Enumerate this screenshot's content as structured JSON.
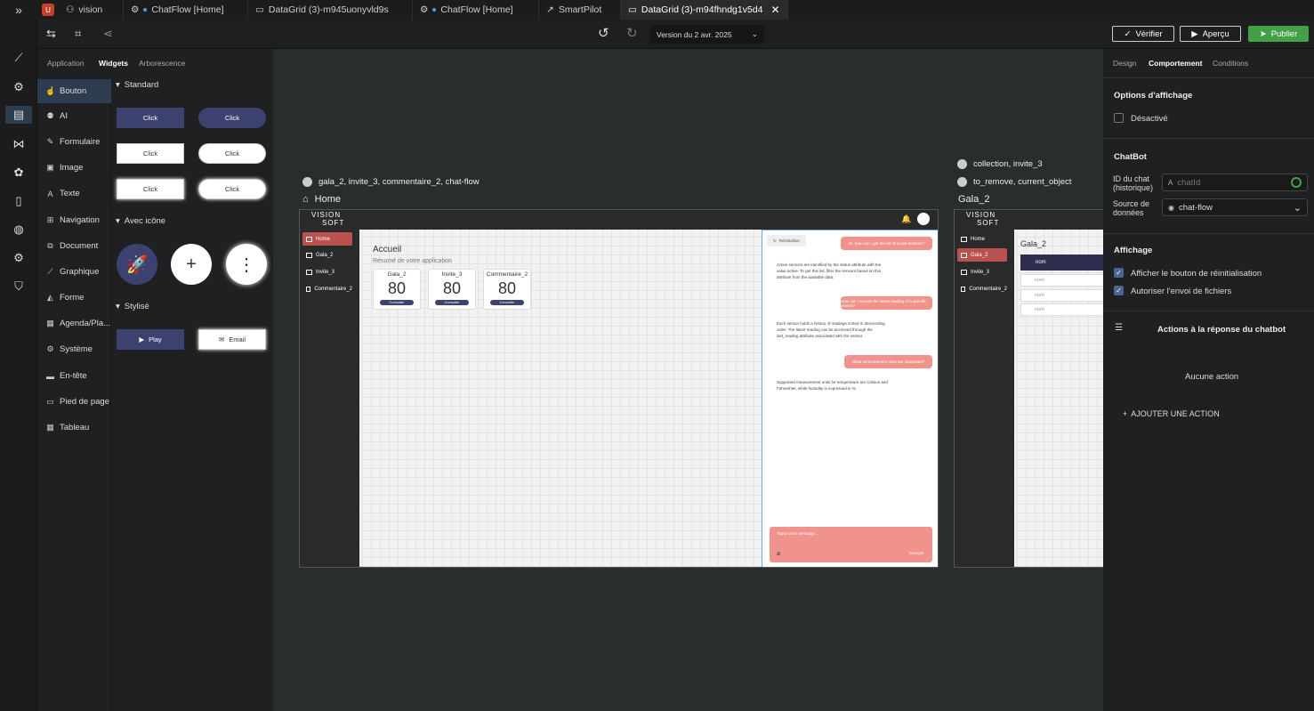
{
  "tabs": [
    {
      "label": "vision"
    },
    {
      "label": "ChatFlow [Home]"
    },
    {
      "label": "DataGrid (3)-m945uonyvld9s"
    },
    {
      "label": "ChatFlow [Home]"
    },
    {
      "label": "SmartPilot"
    },
    {
      "label": "DataGrid (3)-m94fhndg1v5d4"
    }
  ],
  "toolbar": {
    "version": "Version du 2 avr. 2025",
    "verify": "Vérifier",
    "preview": "Aperçu",
    "publish": "Publier"
  },
  "panel": {
    "tabs": [
      "Application",
      "Widgets",
      "Arborescence"
    ],
    "categories": [
      "Bouton",
      "AI",
      "Formulaire",
      "Image",
      "Texte",
      "Navigation",
      "Document",
      "Graphique",
      "Forme",
      "Agenda/Pla...",
      "Système",
      "En-tête",
      "Pied de page",
      "Tableau"
    ],
    "sections": {
      "standard": "Standard",
      "with_icon": "Avec icône",
      "styled": "Stylisé"
    },
    "click": "Click",
    "play": "Play",
    "email": "Email"
  },
  "canvas": {
    "frame1": {
      "datasources": "gala_2, invite_3, commentaire_2, chat-flow",
      "title": "Home",
      "logo_line1": "VISION",
      "logo_line2": "SOFT",
      "nav": [
        "Home",
        "Gala_2",
        "Invite_3",
        "Commentaire_2"
      ],
      "heading": "Accueil",
      "subheading": "Résumé de votre application",
      "stats": [
        {
          "title": "Gala_2",
          "value": "80",
          "button": "Consulter"
        },
        {
          "title": "Invite_3",
          "value": "80",
          "button": "Consulter"
        },
        {
          "title": "Commentaire_2",
          "value": "80",
          "button": "Consulter"
        }
      ],
      "chat": {
        "reset": "Réinitialiser",
        "q1": "Hi, how can I get the list of active sensors?",
        "a1": "Active sensors are identified by the status attribute with the value active. To get this list, filter the sensors based on this attribute from the available data.",
        "q2": "How can I access the latest reading of a specific sensor?",
        "a2": "Each sensor holds a history of readings sorted in descending order. The latest reading can be accessed through the last_reading attribute associated with the sensor.",
        "q3": "What measurement units are supported?",
        "a3": "Supported measurement units for temperature are Celsius and Fahrenheit, while humidity is expressed in %.",
        "placeholder": "Tapez votre message...",
        "send": "Envoyer"
      }
    },
    "frame2": {
      "datasources1": "collection, invite_3",
      "datasources2": "to_remove, current_object",
      "title": "Gala_2",
      "logo_line1": "VISION",
      "logo_line2": "SOFT",
      "nav": [
        "Home",
        "Gala_2",
        "Invite_3",
        "Commentaire_2"
      ],
      "heading": "Gala_2",
      "col": "nom",
      "rows": [
        "nom",
        "nom",
        "nom"
      ]
    }
  },
  "right": {
    "tabs": [
      "Design",
      "Comportement",
      "Conditions"
    ],
    "display_options": "Options d'affichage",
    "disabled": "Désactivé",
    "chatbot": "ChatBot",
    "chat_id_label": "ID du chat (historique)",
    "chat_id_value": "chatId",
    "source_label": "Source de données",
    "source_value": "chat-flow",
    "affichage": "Affichage",
    "show_reset": "Afficher le bouton de réinitialisation",
    "allow_files": "Autoriser l'envoi de fichiers",
    "actions": "Actions à la réponse du chatbot",
    "no_action": "Aucune action",
    "add_action": "AJOUTER UNE ACTION"
  }
}
